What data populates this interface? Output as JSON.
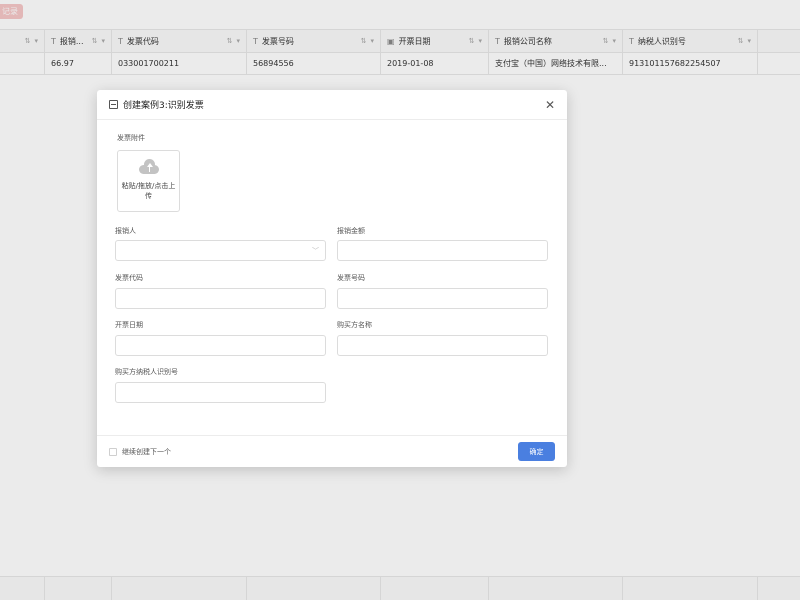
{
  "top_tag": "记录",
  "table": {
    "columns": [
      {
        "type_icon": "",
        "name": "",
        "sort": "⇅",
        "caret": "▾"
      },
      {
        "type_icon": "T",
        "name": "报销...",
        "sort": "⇅",
        "caret": "▾"
      },
      {
        "type_icon": "T",
        "name": "发票代码",
        "sort": "⇅",
        "caret": "▾"
      },
      {
        "type_icon": "T",
        "name": "发票号码",
        "sort": "⇅",
        "caret": "▾"
      },
      {
        "type_icon": "▣",
        "name": "开票日期",
        "sort": "⇅",
        "caret": "▾"
      },
      {
        "type_icon": "T",
        "name": "报销公司名称",
        "sort": "⇅",
        "caret": "▾"
      },
      {
        "type_icon": "T",
        "name": "纳税人识别号",
        "sort": "⇅",
        "caret": "▾"
      }
    ],
    "rows": [
      [
        "",
        "66.97",
        "033001700211",
        "56894556",
        "2019-01-08",
        "支付宝（中国）网络技术有限...",
        "913101157682254507"
      ]
    ]
  },
  "modal": {
    "title": "创建案例3:识别发票",
    "close": "✕",
    "attachment_label": "发票附件",
    "upload_text": "粘贴/拖放/点击上传",
    "fields": {
      "reimburser_label": "报销人",
      "amount_label": "报销金额",
      "invoice_code_label": "发票代码",
      "invoice_number_label": "发票号码",
      "invoice_date_label": "开票日期",
      "buyer_name_label": "购买方名称",
      "buyer_tax_id_label": "购买方纳税人识别号"
    },
    "chevron": "﹀",
    "continue_label": "继续创建下一个",
    "ok_label": "确定"
  }
}
